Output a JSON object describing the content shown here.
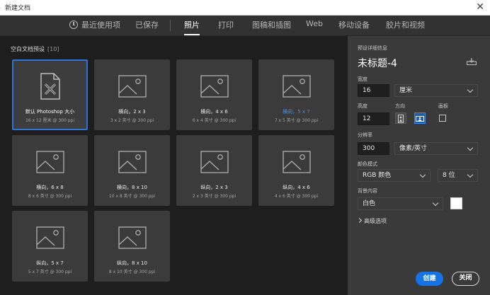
{
  "window": {
    "title": "新建文档",
    "close_glyph": "✕"
  },
  "tabs": [
    {
      "label": "最近使用项"
    },
    {
      "label": "已保存"
    },
    {
      "label": "照片",
      "active": true
    },
    {
      "label": "打印"
    },
    {
      "label": "图稿和插图"
    },
    {
      "label": "Web"
    },
    {
      "label": "移动设备"
    },
    {
      "label": "胶片和视频"
    }
  ],
  "presets": {
    "section_label": "空白文档预设",
    "count": "[10]",
    "items": [
      {
        "name": "默认 Photoshop 大小",
        "sub": "16 x 12 厘米 @ 300 ppi",
        "icon": "document-icon",
        "selected": true
      },
      {
        "name": "横向，2 x 3",
        "sub": "3 x 2 英寸 @ 300 ppi",
        "icon": "image-icon"
      },
      {
        "name": "横向，4 x 6",
        "sub": "6 x 4 英寸 @ 300 ppi",
        "icon": "image-icon"
      },
      {
        "name": "横向，5 x 7",
        "sub": "7 x 5 英寸 @ 300 ppi",
        "icon": "image-icon",
        "highlight": true
      },
      {
        "name": "横向，6 x 8",
        "sub": "8 x 6 英寸 @ 300 ppi",
        "icon": "image-icon"
      },
      {
        "name": "横向，8 x 10",
        "sub": "10 x 8 英寸 @ 300 ppi",
        "icon": "image-icon"
      },
      {
        "name": "纵向，2 x 3",
        "sub": "2 x 3 英寸 @ 300 ppi",
        "icon": "image-icon"
      },
      {
        "name": "纵向，4 x 6",
        "sub": "4 x 6 英寸 @ 300 ppi",
        "icon": "image-icon"
      },
      {
        "name": "纵向，5 x 7",
        "sub": "5 x 7 英寸 @ 300 ppi",
        "icon": "image-icon"
      },
      {
        "name": "纵向，8 x 10",
        "sub": "8 x 10 英寸 @ 300 ppi",
        "icon": "image-icon"
      }
    ]
  },
  "details": {
    "header": "预设详细信息",
    "doc_title": "未标题-4",
    "width_label": "宽度",
    "width_value": "16",
    "width_unit": "厘米",
    "height_label": "高度",
    "height_value": "12",
    "orientation_label": "方向",
    "artboard_label": "画板",
    "resolution_label": "分辨率",
    "resolution_value": "300",
    "resolution_unit": "像素/英寸",
    "color_mode_label": "颜色模式",
    "color_mode_value": "RGB 颜色",
    "bit_depth_value": "8 位",
    "background_label": "背景内容",
    "background_value": "白色",
    "background_swatch": "#ffffff",
    "advanced_label": "高级选项",
    "create_button": "创建",
    "close_button": "关闭"
  },
  "colors": {
    "accent": "#1473e6",
    "selection_border": "#2b73d6",
    "link_blue": "#4a90e2"
  }
}
